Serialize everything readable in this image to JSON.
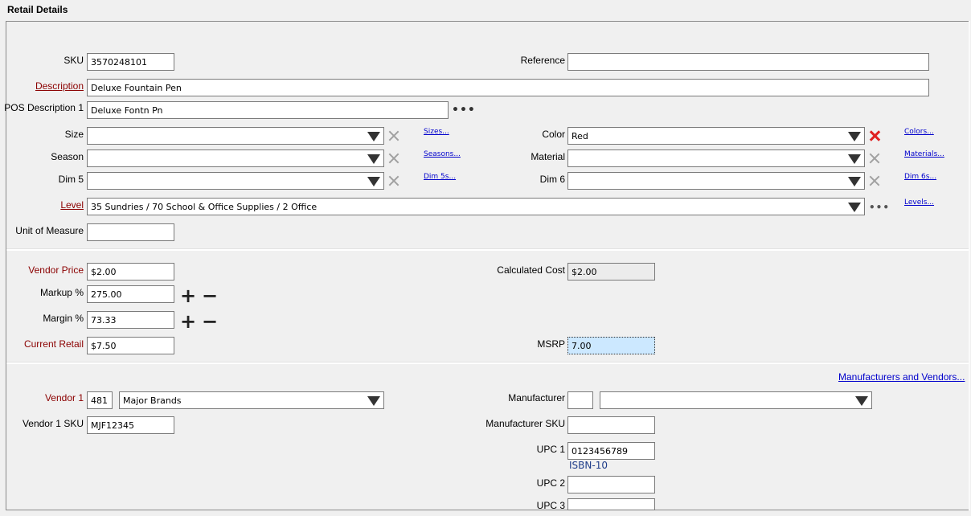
{
  "title": "Retail Details",
  "labels": {
    "sku": "SKU",
    "reference": "Reference",
    "description": "Description",
    "pos_description": "POS Description 1",
    "size": "Size",
    "color": "Color",
    "season": "Season",
    "material": "Material",
    "dim5": "Dim 5",
    "dim6": "Dim 6",
    "level": "Level",
    "unit_of_measure": "Unit of Measure",
    "vendor_price": "Vendor Price",
    "calculated_cost": "Calculated Cost",
    "markup": "Markup %",
    "margin": "Margin %",
    "current_retail": "Current Retail",
    "msrp": "MSRP",
    "vendor1": "Vendor 1",
    "manufacturer": "Manufacturer",
    "vendor1_sku": "Vendor 1 SKU",
    "manufacturer_sku": "Manufacturer SKU",
    "upc1": "UPC 1",
    "upc2": "UPC 2",
    "upc3": "UPC 3"
  },
  "values": {
    "sku": "3570248101",
    "reference": "",
    "description": "Deluxe Fountain Pen",
    "pos_description": "Deluxe Fontn Pn",
    "size": "",
    "color": "Red",
    "season": "",
    "material": "",
    "dim5": "",
    "dim6": "",
    "level": "35 Sundries / 70 School & Office Supplies / 2 Office",
    "unit_of_measure": "",
    "vendor_price": "$2.00",
    "calculated_cost": "$2.00",
    "markup": "275.00",
    "margin": "73.33",
    "current_retail": "$7.50",
    "msrp": "7.00",
    "vendor1_code": "481",
    "vendor1_name": "Major Brands",
    "manufacturer_code": "",
    "manufacturer_name": "",
    "vendor1_sku": "MJF12345",
    "manufacturer_sku": "",
    "upc1": "0123456789",
    "upc1_type": "ISBN-10",
    "upc2": "",
    "upc3": ""
  },
  "links": {
    "sizes": "Sizes...",
    "colors": "Colors...",
    "seasons": "Seasons...",
    "materials": "Materials...",
    "dim5s": "Dim 5s...",
    "dim6s": "Dim 6s...",
    "levels": "Levels...",
    "manufacturers_vendors": "Manufacturers and Vendors..."
  },
  "icons": {
    "ellipsis": "•••",
    "plus": "+",
    "minus": "−"
  },
  "colors": {
    "required_label": "#8b0000",
    "link": "#0000cc",
    "clear_active": "#e02020",
    "selected_field": "#cce8ff"
  }
}
